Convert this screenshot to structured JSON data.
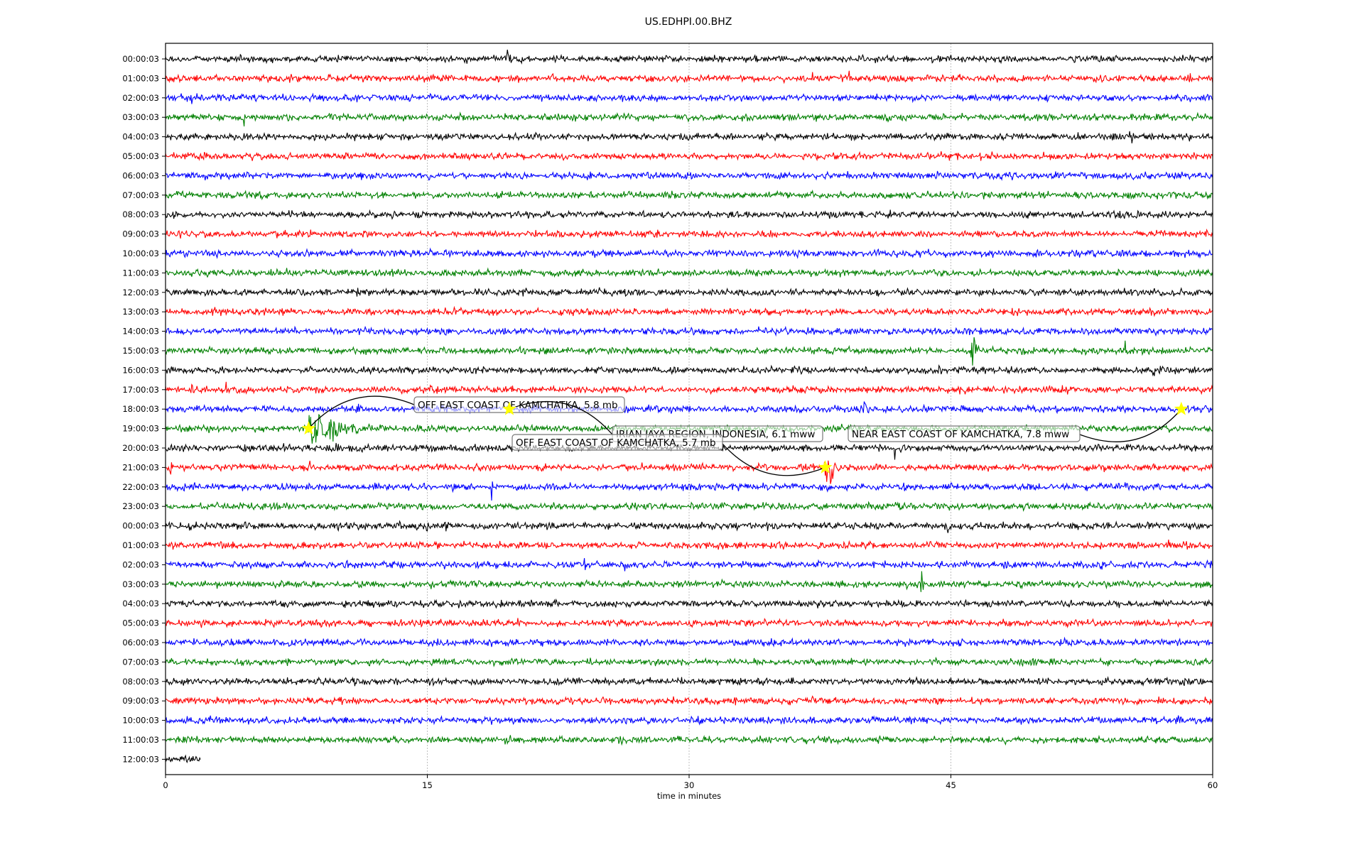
{
  "chart_data": {
    "type": "line",
    "title": "US.EDHPI.00.BHZ",
    "xlabel": "time in minutes",
    "xlim": [
      0,
      60
    ],
    "xticks": [
      "0",
      "15",
      "30",
      "45",
      "60"
    ],
    "grid": "vertical dotted at 15, 30, 45",
    "colors": [
      "#000000",
      "#ff0000",
      "#0000ff",
      "#008000"
    ],
    "rows": [
      "00:00:03",
      "01:00:03",
      "02:00:03",
      "03:00:03",
      "04:00:03",
      "05:00:03",
      "06:00:03",
      "07:00:03",
      "08:00:03",
      "09:00:03",
      "10:00:03",
      "11:00:03",
      "12:00:03",
      "13:00:03",
      "14:00:03",
      "15:00:03",
      "16:00:03",
      "17:00:03",
      "18:00:03",
      "19:00:03",
      "20:00:03",
      "21:00:03",
      "22:00:03",
      "23:00:03",
      "00:00:03",
      "01:00:03",
      "02:00:03",
      "03:00:03",
      "04:00:03",
      "05:00:03",
      "06:00:03",
      "07:00:03",
      "08:00:03",
      "09:00:03",
      "10:00:03",
      "11:00:03",
      "12:00:03"
    ],
    "last_row_end_minute": 2,
    "bursts": [
      [
        0,
        4.3,
        3,
        0.1
      ],
      [
        0,
        19.6,
        7,
        0.3
      ],
      [
        1,
        35.5,
        3,
        0.2
      ],
      [
        1,
        37,
        3,
        0.3
      ],
      [
        1,
        39.2,
        3,
        0.1
      ],
      [
        1,
        42.8,
        2,
        0.4
      ],
      [
        1,
        58.5,
        1.5,
        1.5
      ],
      [
        2,
        1.5,
        2,
        0.1
      ],
      [
        2,
        0.5,
        1.3,
        8
      ],
      [
        3,
        4.5,
        4,
        0.1
      ],
      [
        4,
        21.2,
        2.5,
        0.4
      ],
      [
        4,
        54.3,
        6,
        0.2
      ],
      [
        4,
        55.2,
        3,
        0.6
      ],
      [
        4,
        33,
        1.5,
        0.5
      ],
      [
        14,
        20,
        1.5,
        0.8
      ],
      [
        14,
        5.5,
        1.3,
        0.5
      ],
      [
        15,
        46.2,
        6,
        0.5
      ],
      [
        15,
        47,
        3,
        0.4
      ],
      [
        15,
        55,
        3,
        0.2
      ],
      [
        15,
        56,
        3,
        0.3
      ],
      [
        15,
        52.5,
        2,
        0.1
      ],
      [
        16,
        44.3,
        3,
        0.3
      ],
      [
        16,
        56.6,
        2.5,
        0.3
      ],
      [
        16,
        34,
        2,
        0.2
      ],
      [
        16,
        49,
        2,
        0.2
      ],
      [
        17,
        1.5,
        3,
        0.2
      ],
      [
        17,
        3.5,
        4,
        0.1
      ],
      [
        17,
        11.5,
        3,
        0.2
      ],
      [
        17,
        13.5,
        3,
        0.2
      ],
      [
        17,
        15.2,
        3,
        0.2
      ],
      [
        17,
        19.5,
        2,
        0.3
      ],
      [
        17,
        21,
        2,
        0.3
      ],
      [
        17,
        41,
        2,
        0.2
      ],
      [
        17,
        43.2,
        4,
        0.1
      ],
      [
        18,
        5.2,
        2,
        0.1
      ],
      [
        18,
        11,
        2,
        0.3
      ],
      [
        18,
        40,
        3,
        0.6
      ],
      [
        18,
        45,
        2,
        0.2
      ],
      [
        18,
        51,
        2,
        0.2
      ],
      [
        19,
        8.2,
        7,
        3.5
      ],
      [
        19,
        5.3,
        1.5,
        0.1
      ],
      [
        20,
        4.5,
        1.5,
        0.6
      ],
      [
        20,
        41.8,
        5,
        0.1
      ],
      [
        20,
        53.3,
        1.5,
        0.1
      ],
      [
        21,
        0.3,
        3,
        0.2
      ],
      [
        21,
        8.3,
        2,
        0.2
      ],
      [
        21,
        27.3,
        2,
        0.2
      ],
      [
        21,
        37.8,
        9,
        0.8
      ],
      [
        21,
        36.5,
        3,
        0.3
      ],
      [
        22,
        12,
        2,
        0.1
      ],
      [
        22,
        16.5,
        2,
        0.5
      ],
      [
        22,
        18.7,
        6,
        0.1
      ],
      [
        22,
        28,
        2,
        0.2
      ],
      [
        23,
        22.3,
        2,
        0.1
      ],
      [
        23,
        27.4,
        2,
        0.1
      ],
      [
        24,
        5.3,
        3,
        0.2
      ],
      [
        24,
        15,
        3,
        0.1
      ],
      [
        24,
        16,
        4,
        0.5
      ],
      [
        24,
        34.5,
        3,
        0.5
      ],
      [
        24,
        36.3,
        4,
        0.1
      ],
      [
        24,
        44.8,
        5,
        0.1
      ],
      [
        25,
        57.5,
        4,
        0.2
      ],
      [
        25,
        58.5,
        3,
        0.1
      ],
      [
        26,
        16,
        2,
        0.3
      ],
      [
        26,
        24,
        4,
        0.1
      ],
      [
        26,
        26.3,
        4,
        0.1
      ],
      [
        26,
        35,
        2,
        0.2
      ],
      [
        27,
        15.2,
        2,
        0.1
      ],
      [
        27,
        43.3,
        5,
        0.3
      ],
      [
        27,
        42.5,
        2,
        0.5
      ]
    ],
    "events": [
      {
        "label": "OFF EAST COAST OF KAMCHATKA, 5.8 mb",
        "row": 19,
        "minute": 8.2
      },
      {
        "label": "IRIAN JAYA REGION, INDONESIA, 6.1 mww",
        "row": 18,
        "minute": 19.7
      },
      {
        "label": "OFF EAST COAST OF KAMCHATKA, 5.7 mb",
        "row": 21,
        "minute": 37.8
      },
      {
        "label": "NEAR EAST COAST OF KAMCHATKA, 7.8 mww",
        "row": 18,
        "minute": 58.2
      }
    ],
    "star_color": "#ffff00"
  }
}
